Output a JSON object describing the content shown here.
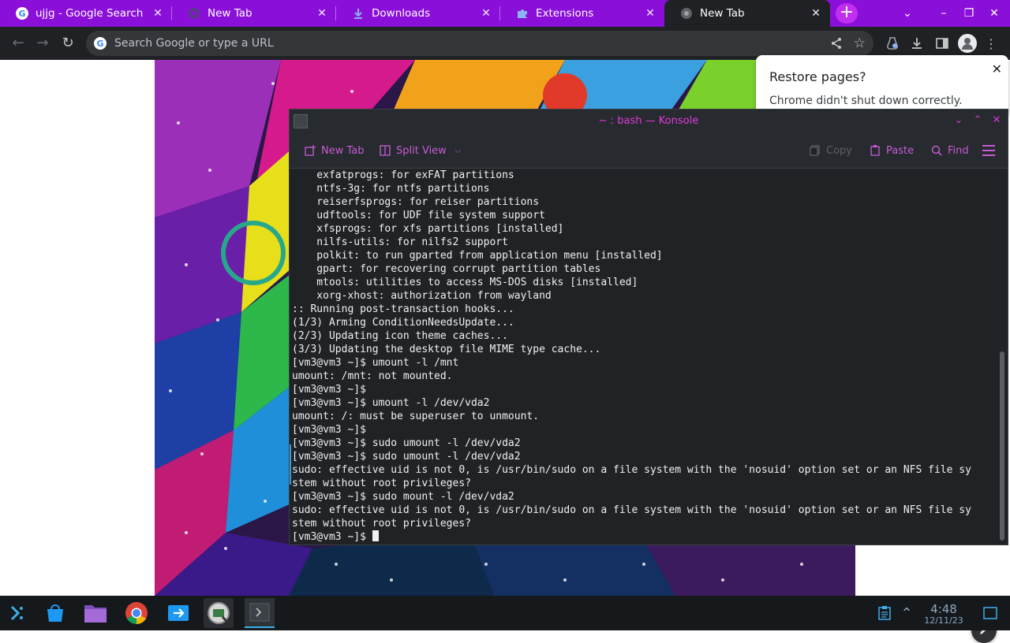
{
  "browser": {
    "tabs": [
      {
        "title": "ujjg - Google Search",
        "icon": "google-icon"
      },
      {
        "title": "New Tab",
        "icon": "chrome-icon"
      },
      {
        "title": "Downloads",
        "icon": "download-icon"
      },
      {
        "title": "Extensions",
        "icon": "puzzle-icon"
      },
      {
        "title": "New Tab",
        "icon": "chrome-icon",
        "active": true
      }
    ],
    "omnibox": {
      "placeholder": "Search Google or type a URL",
      "value": ""
    },
    "colors": {
      "tabstrip": "#8a0fd9",
      "toolbar": "#202124",
      "new_tab_button": "#c22ef0"
    }
  },
  "restore_bubble": {
    "title": "Restore pages?",
    "message": "Chrome didn't shut down correctly."
  },
  "konsole": {
    "title": "~ : bash — Konsole",
    "toolbar": {
      "new_tab": "New Tab",
      "split_view": "Split View",
      "copy": "Copy",
      "paste": "Paste",
      "find": "Find"
    },
    "lines": [
      "    exfatprogs: for exFAT partitions",
      "    ntfs-3g: for ntfs partitions",
      "    reiserfsprogs: for reiser partitions",
      "    udftools: for UDF file system support",
      "    xfsprogs: for xfs partitions [installed]",
      "    nilfs-utils: for nilfs2 support",
      "    polkit: to run gparted from application menu [installed]",
      "    gpart: for recovering corrupt partition tables",
      "    mtools: utilities to access MS-DOS disks [installed]",
      "    xorg-xhost: authorization from wayland",
      ":: Running post-transaction hooks...",
      "(1/3) Arming ConditionNeedsUpdate...",
      "(2/3) Updating icon theme caches...",
      "(3/3) Updating the desktop file MIME type cache...",
      "[vm3@vm3 ~]$ umount -l /mnt",
      "umount: /mnt: not mounted.",
      "[vm3@vm3 ~]$",
      "[vm3@vm3 ~]$ umount -l /dev/vda2",
      "umount: /: must be superuser to unmount.",
      "[vm3@vm3 ~]$",
      "[vm3@vm3 ~]$ sudo umount -l /dev/vda2",
      "[vm3@vm3 ~]$ sudo umount -l /dev/vda2",
      "sudo: effective uid is not 0, is /usr/bin/sudo on a file system with the 'nosuid' option set or an NFS file sy",
      "stem without root privileges?",
      "[vm3@vm3 ~]$ sudo mount -l /dev/vda2",
      "sudo: effective uid is not 0, is /usr/bin/sudo on a file system with the 'nosuid' option set or an NFS file sy",
      "stem without root privileges?"
    ],
    "prompt": "[vm3@vm3 ~]$ ",
    "colors": {
      "background": "#202326",
      "text": "#eff0f1",
      "accent": "#d53cd6"
    }
  },
  "taskbar": {
    "apps": [
      "application-launcher-icon",
      "discover-store-icon",
      "file-manager-icon",
      "chrome-icon",
      "send-app-icon",
      "system-monitor-icon",
      "konsole-icon"
    ],
    "clock": {
      "time": "4:48",
      "date": "12/11/23"
    }
  }
}
